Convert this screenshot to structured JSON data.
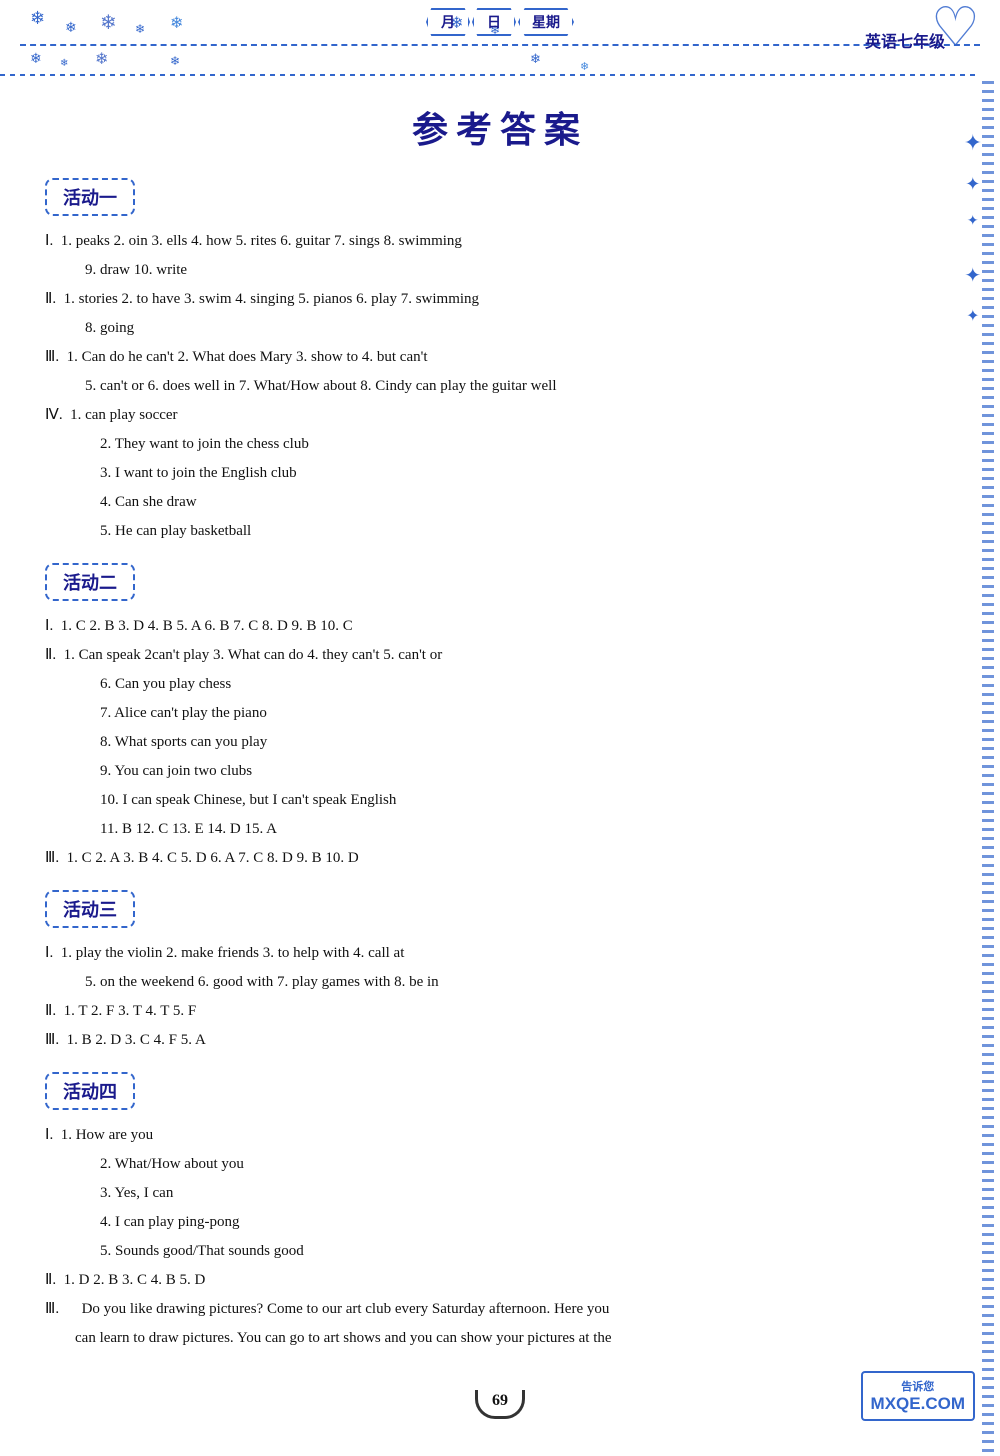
{
  "header": {
    "month_label": "月",
    "day_label": "日",
    "week_label": "星期",
    "subject": "英语七年级",
    "deco_stars": [
      "❄",
      "❄",
      "❄",
      "❄",
      "❄",
      "❄",
      "❄",
      "❄"
    ]
  },
  "page_title": "参考答案",
  "sections": [
    {
      "name": "活动一",
      "parts": [
        {
          "roman": "Ⅰ",
          "lines": [
            "1. peaks  2. oin  3. ells  4. how  5. rites  6. guitar  7. sings  8. swimming",
            "9. draw  10. write"
          ]
        },
        {
          "roman": "Ⅱ",
          "lines": [
            "1. stories  2. to have  3. swim  4. singing  5. pianos  6. play  7. swimming",
            "8. going"
          ]
        },
        {
          "roman": "Ⅲ",
          "lines": [
            "1. Can  do  he  can't  2. What  does  Mary  3. show  to  4. but  can't",
            "5. can't  or  6. does  well  in  7. What/How  about  8. Cindy can play the guitar well"
          ]
        },
        {
          "roman": "Ⅳ",
          "lines": [
            "1. can play soccer",
            "2. They want to join the chess club",
            "3. I want to join the English club",
            "4. Can she draw",
            "5. He can play basketball"
          ],
          "indent": true
        }
      ]
    },
    {
      "name": "活动二",
      "parts": [
        {
          "roman": "Ⅰ",
          "lines": [
            "1. C  2. B  3. D  4. B  5. A  6. B  7. C  8. D  9. B  10. C"
          ]
        },
        {
          "roman": "Ⅱ",
          "lines": [
            "1. Can  speak  2can't  play  3. What  can  do  4. they  can't  5. can't  or",
            "6. Can you play chess",
            "7. Alice can't play the piano",
            "8. What sports can you play",
            "9. You can join two clubs",
            "10. I can speak Chinese, but I can't speak English",
            "11. B  12. C  13. E  14. D  15. A"
          ],
          "indent_from": 1
        },
        {
          "roman": "Ⅲ",
          "lines": [
            "1. C  2. A  3. B  4. C  5. D  6. A  7. C  8. D  9. B  10. D"
          ]
        }
      ]
    },
    {
      "name": "活动三",
      "parts": [
        {
          "roman": "Ⅰ",
          "lines": [
            "1. play  the  violin  2. make  friends  3. to  help  with  4. call  at",
            "5. on  the  weekend  6. good  with  7. play  games  with  8. be  in"
          ]
        },
        {
          "roman": "Ⅱ",
          "lines": [
            "1. T  2. F  3. T  4. T  5. F"
          ]
        },
        {
          "roman": "Ⅲ",
          "lines": [
            "1. B  2. D  3. C  4. F  5. A"
          ]
        }
      ]
    },
    {
      "name": "活动四",
      "parts": [
        {
          "roman": "Ⅰ",
          "lines": [
            "1. How are you",
            "2. What/How about you",
            "3. Yes, I can",
            "4. I can play ping-pong",
            "5. Sounds good/That sounds good"
          ],
          "indent": true
        },
        {
          "roman": "Ⅱ",
          "lines": [
            "1. D  2. B  3. C  4. B  5. D"
          ]
        },
        {
          "roman": "Ⅲ",
          "lines": [
            "Do you like drawing pictures? Come to our art club every Saturday afternoon.  Here you",
            "can learn to draw pictures.  You can go to art shows and you can show your pictures at the"
          ],
          "paragraph": true
        }
      ]
    }
  ],
  "footer": {
    "page_num": "69",
    "watermark_top": "告诉您",
    "watermark_url": "MXQE.COM"
  }
}
